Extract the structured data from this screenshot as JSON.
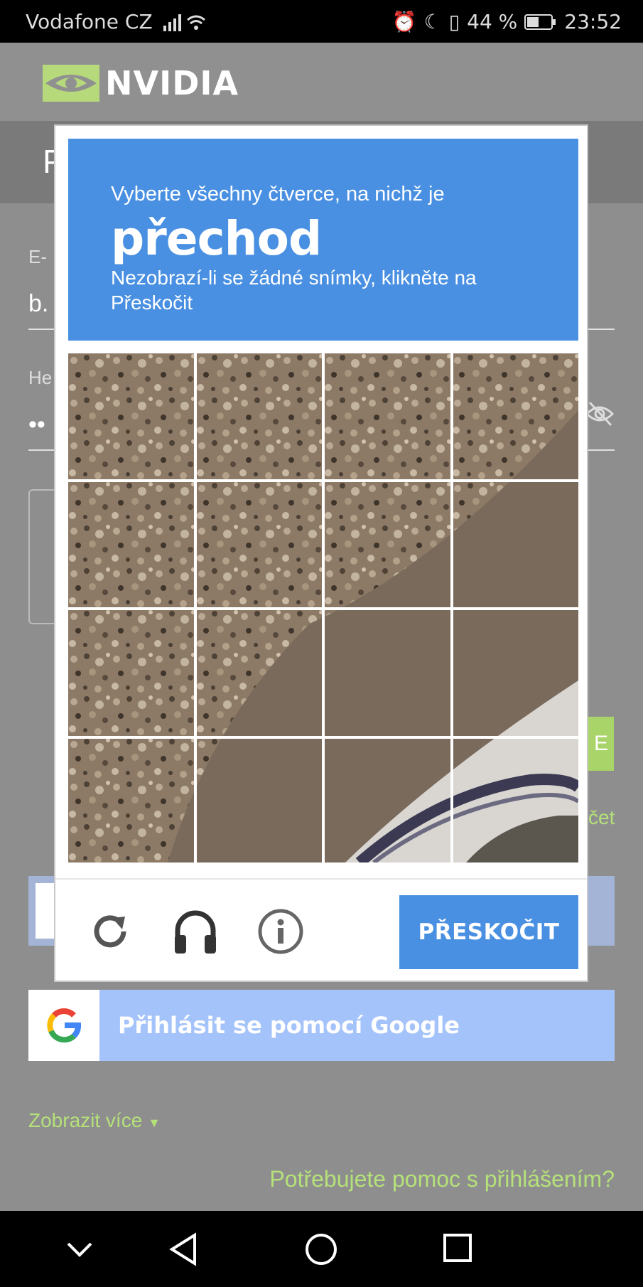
{
  "statusbar": {
    "carrier": "Vodafone CZ",
    "battery": "44 %",
    "time": "23:52"
  },
  "brand": {
    "name": "NVIDIA"
  },
  "page": {
    "title_initial": "P",
    "email_label_fragment": "E-",
    "email_value_fragment": "b.",
    "password_label_fragment": "He",
    "password_value_fragment": "••",
    "green_btn_fragment": "E",
    "green_link_fragment": "čet",
    "google_button": "Přihlásit se pomocí Google",
    "show_more": "Zobrazit více",
    "show_more_arrow": "▼",
    "help_link": "Potřebujete pomoc s přihlášením?"
  },
  "captcha": {
    "instruction": "Vyberte všechny čtverce, na nichž je",
    "target": "přechod",
    "hint": "Nezobrazí-li se žádné snímky, klikněte na Přeskočit",
    "skip_button": "PŘESKOČIT",
    "icons": [
      "reload-icon",
      "headphones-icon",
      "info-icon"
    ]
  }
}
